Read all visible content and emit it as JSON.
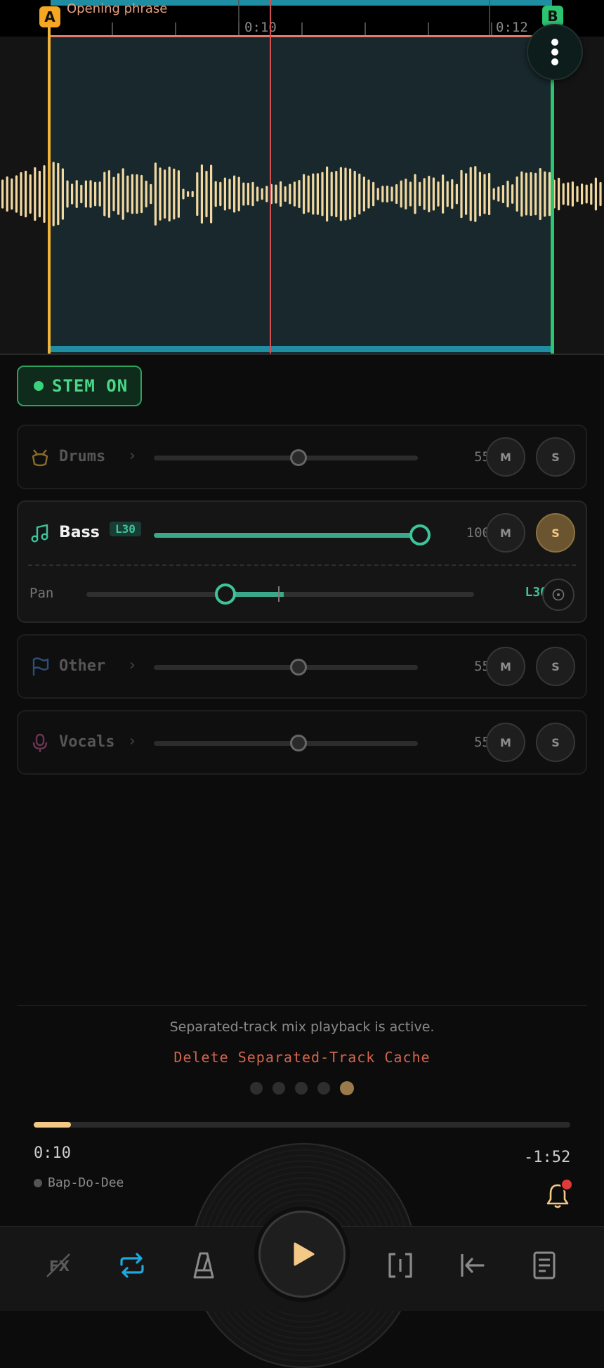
{
  "waveform": {
    "marker_a": "A",
    "marker_b": "B",
    "loop_label": "Opening phrase",
    "ticks": [
      "0:10",
      "0:12"
    ]
  },
  "stem_toggle": {
    "label": "STEM ON"
  },
  "tracks": [
    {
      "name": "Drums",
      "volume": "55",
      "volume_level": 0.55,
      "mute": "M",
      "solo": "S",
      "icon": "drum-icon"
    },
    {
      "name": "Bass",
      "volume": "100",
      "volume_level": 1.0,
      "mute": "M",
      "solo": "S",
      "icon": "music-note-icon",
      "pan_badge": "L30",
      "pan_label": "Pan",
      "pan_value": "L30"
    },
    {
      "name": "Other",
      "volume": "55",
      "volume_level": 0.55,
      "mute": "M",
      "solo": "S",
      "icon": "flag-icon"
    },
    {
      "name": "Vocals",
      "volume": "55",
      "volume_level": 0.55,
      "mute": "M",
      "solo": "S",
      "icon": "microphone-icon"
    }
  ],
  "status": {
    "message": "Separated-track mix playback is active.",
    "delete_cache": "Delete Separated-Track Cache"
  },
  "pager": {
    "count": 5,
    "active": 5
  },
  "player": {
    "elapsed": "0:10",
    "remaining": "-1:52",
    "progress": 0.07,
    "track_title": "Bap-Do-Dee"
  },
  "toolbar": {
    "buttons": [
      "fx-off-icon",
      "repeat-icon",
      "metronome-icon",
      "play-icon",
      "text-cursor-icon",
      "skip-to-start-icon",
      "notes-icon"
    ]
  },
  "colors": {
    "accent_green": "#3ec49b",
    "marker_a": "#f5a623",
    "marker_b": "#2bc470",
    "waveform": "#f3d9a0",
    "loop_accent": "#1f8ea3",
    "solo_active": "#6b5530",
    "delete_red": "#d4644e",
    "repeat_blue": "#1fa8e0"
  }
}
